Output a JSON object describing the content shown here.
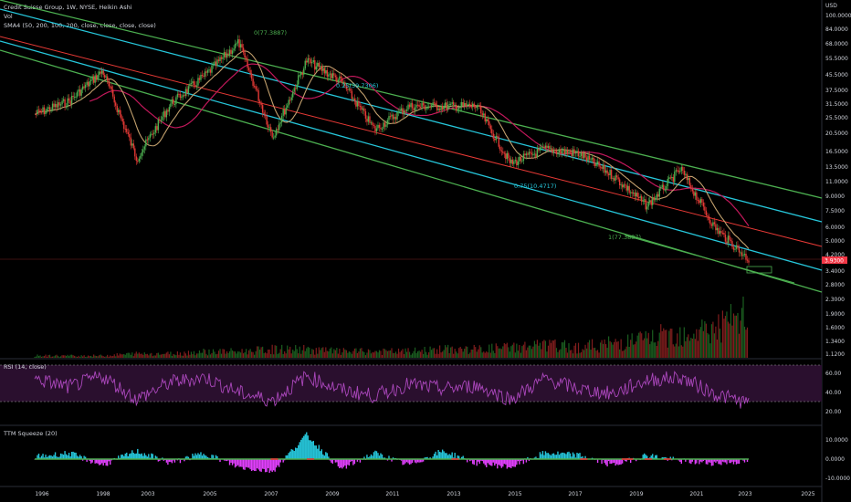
{
  "header": {
    "title": "Credit Suisse Group, 1W, NYSE, Heikin Ashi",
    "vol": "Vol",
    "sma": "SMA4 (50, 200, 100, 200, close, close, close, close)"
  },
  "price_axis": {
    "currency": "USD",
    "ticks": [
      "100.0000",
      "84.0000",
      "68.0000",
      "55.5000",
      "45.5000",
      "37.5000",
      "31.5000",
      "25.5000",
      "20.5000",
      "16.5000",
      "13.5000",
      "11.0000",
      "9.0000",
      "7.5000",
      "6.0000",
      "5.0000",
      "4.2000",
      "3.4000",
      "2.8000",
      "2.3000",
      "1.9000",
      "1.6000",
      "1.3400",
      "1.1200"
    ],
    "last_price": "3.9300"
  },
  "fib_labels": [
    {
      "text": "0(77.3887)"
    },
    {
      "text": "0.25(39.7306)"
    },
    {
      "text": "0.75(10.4717)"
    },
    {
      "text": "1(77.3887)"
    }
  ],
  "rsi": {
    "label": "RSI (14, close)",
    "ticks": [
      "60.00",
      "40.00",
      "20.00"
    ]
  },
  "ttm": {
    "label": "TTM Squeeze (20)",
    "ticks": [
      "10.0000",
      "0.0000",
      "-10.0000"
    ]
  },
  "time_axis": {
    "ticks": [
      "1996",
      "1998",
      "2003",
      "2005",
      "2007",
      "2009",
      "2011",
      "2013",
      "2015",
      "2017",
      "2019",
      "2021",
      "2023",
      "2025"
    ]
  },
  "colors": {
    "background": "#000000",
    "channel_green": "#4caf50",
    "channel_cyan": "#26c6da",
    "channel_red": "#e53935",
    "sma_fast": "#c2a06d",
    "sma_slow": "#c2185b",
    "rsi_line": "#ab47bc",
    "rsi_band": "#2a0f2e",
    "squeeze_up": "#26c6da",
    "squeeze_down": "#e040fb",
    "candle_up": "#4caf50",
    "candle_down": "#e53935"
  },
  "chart_data": [
    {
      "type": "candlestick",
      "name": "CS price (weekly, Heikin Ashi)",
      "x": [
        "1996",
        "1998",
        "2000",
        "2003",
        "2005",
        "2007",
        "2008",
        "2009",
        "2010",
        "2011",
        "2012",
        "2013",
        "2014",
        "2015",
        "2016",
        "2017",
        "2018",
        "2019",
        "2020",
        "2021",
        "2022",
        "2022.8"
      ],
      "close": [
        27,
        32,
        48,
        15,
        31,
        45,
        70,
        20,
        55,
        42,
        22,
        30,
        30,
        30,
        14,
        17,
        16,
        12,
        8,
        13,
        6,
        3.93
      ],
      "yscale": "log"
    },
    {
      "type": "bar",
      "name": "Vol",
      "values": [
        1,
        1,
        1,
        2,
        2,
        3,
        3,
        4,
        4,
        3,
        3,
        3,
        4,
        4,
        5,
        6,
        5,
        7,
        9,
        12,
        14,
        20
      ]
    },
    {
      "type": "line",
      "name": "RSI",
      "values": [
        60,
        48,
        64,
        30,
        55,
        62,
        40,
        28,
        64,
        44,
        35,
        52,
        45,
        50,
        30,
        60,
        45,
        38,
        58,
        62,
        38,
        24
      ],
      "ylim": [
        0,
        80
      ]
    },
    {
      "type": "bar",
      "name": "TTM Squeeze",
      "values": [
        1,
        3,
        -3,
        4,
        -2,
        3,
        -4,
        -6,
        12,
        -5,
        3,
        -3,
        4,
        -2,
        -4,
        3,
        2,
        -3,
        2,
        -1,
        -2,
        -1
      ],
      "ylim": [
        -12,
        14
      ]
    }
  ]
}
